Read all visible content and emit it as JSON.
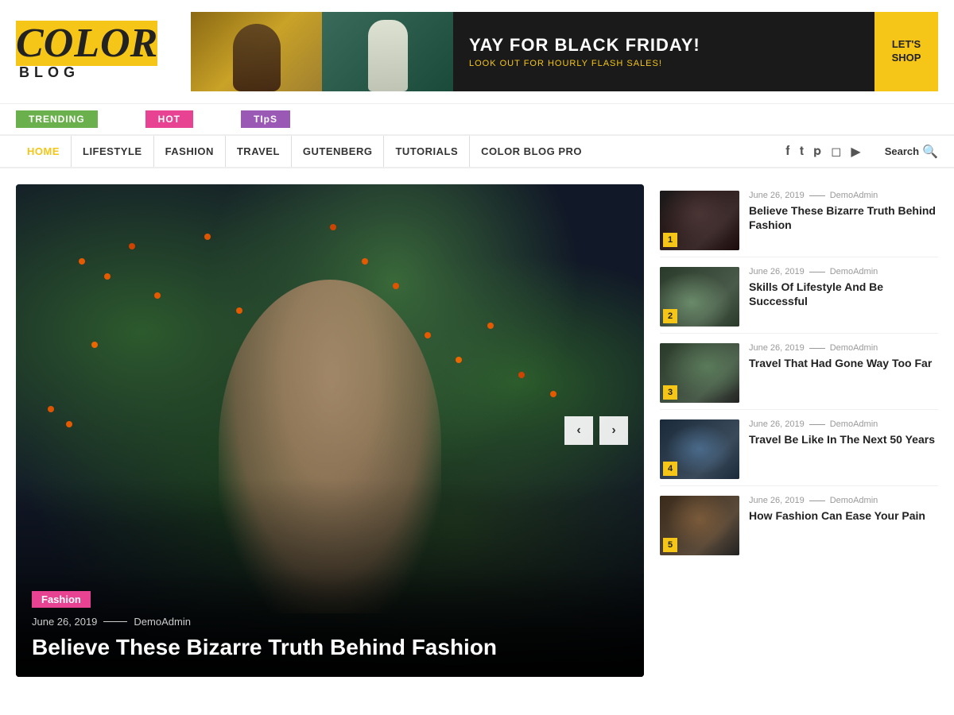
{
  "header": {
    "logo_color": "COLOR",
    "logo_blog": "BLOG"
  },
  "banner": {
    "title": "YAY FOR BLACK FRIDAY!",
    "subtitle": "LOOK OUT FOR HOURLY FLASH SALES!",
    "cta": "LET'S\nSHOP"
  },
  "tags": [
    {
      "label": "TRENDING",
      "color": "#6ab04c"
    },
    {
      "label": "HOT",
      "color": "#e84393"
    },
    {
      "label": "TIpS",
      "color": "#9b59b6"
    }
  ],
  "nav": {
    "items": [
      "HOME",
      "LIFESTYLE",
      "FASHION",
      "TRAVEL",
      "GUTENBERG",
      "TUTORIALS",
      "COLOR BLOG PRO"
    ],
    "search_label": "Search"
  },
  "hero": {
    "category": "Fashion",
    "date": "June 26, 2019",
    "author": "DemoAdmin",
    "title": "Believe These Bizarre Truth Behind Fashion",
    "prev_label": "‹",
    "next_label": "›"
  },
  "sidebar": {
    "items": [
      {
        "num": "1",
        "date": "June 26, 2019",
        "author": "DemoAdmin",
        "title": "Believe These Bizarre Truth Behind Fashion"
      },
      {
        "num": "2",
        "date": "June 26, 2019",
        "author": "DemoAdmin",
        "title": "Skills Of Lifestyle And Be Successful"
      },
      {
        "num": "3",
        "date": "June 26, 2019",
        "author": "DemoAdmin",
        "title": "Travel That Had Gone Way Too Far"
      },
      {
        "num": "4",
        "date": "June 26, 2019",
        "author": "DemoAdmin",
        "title": "Travel Be Like In The Next 50 Years"
      },
      {
        "num": "5",
        "date": "June 26, 2019",
        "author": "DemoAdmin",
        "title": "How Fashion Can Ease Your Pain"
      }
    ]
  },
  "social_icons": [
    "f",
    "t",
    "p",
    "◻",
    "▶"
  ]
}
